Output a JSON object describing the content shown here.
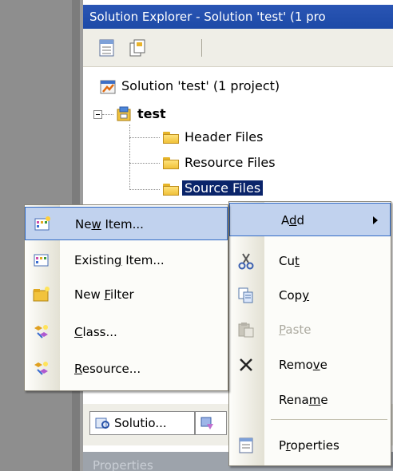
{
  "solution_explorer": {
    "title": "Solution Explorer - Solution 'test' (1 pro",
    "tree": {
      "solution": "Solution 'test' (1 project)",
      "project": "test",
      "folders": [
        "Header Files",
        "Resource Files",
        "Source Files"
      ]
    }
  },
  "bottom_tabs": {
    "solution_tab": "Solutio...",
    "properties_label": "Properties"
  },
  "add_submenu": {
    "items": [
      {
        "pre": "Ne",
        "acc": "w",
        "post": " Item...",
        "icon": "new-item-icon"
      },
      {
        "pre": "Existin",
        "acc": "g",
        "post": " Item...",
        "icon": "existing-item-icon"
      },
      {
        "pre": "New ",
        "acc": "F",
        "post": "ilter",
        "icon": "new-filter-icon"
      },
      {
        "pre": "",
        "acc": "C",
        "post": "lass...",
        "icon": "class-icon"
      },
      {
        "pre": "",
        "acc": "R",
        "post": "esource...",
        "icon": "resource-icon"
      }
    ]
  },
  "context_menu": {
    "items": [
      {
        "pre": "A",
        "acc": "d",
        "post": "d",
        "icon": "",
        "state": "highlighted"
      },
      {
        "pre": "Cu",
        "acc": "t",
        "post": "",
        "icon": "cut-icon"
      },
      {
        "pre": "Cop",
        "acc": "y",
        "post": "",
        "icon": "copy-icon"
      },
      {
        "pre": "",
        "acc": "P",
        "post": "aste",
        "icon": "paste-icon",
        "state": "disabled"
      },
      {
        "pre": "Remo",
        "acc": "v",
        "post": "e",
        "icon": "remove-icon"
      },
      {
        "pre": "Rena",
        "acc": "m",
        "post": "e",
        "icon": ""
      },
      {
        "pre": "P",
        "acc": "r",
        "post": "operties",
        "icon": "properties-icon"
      }
    ]
  },
  "colors": {
    "title_bar": "#1d4aa7",
    "selection": "#0a246a",
    "menu_highlight": "#c1d2ee",
    "menu_highlight_border": "#316ac5"
  }
}
